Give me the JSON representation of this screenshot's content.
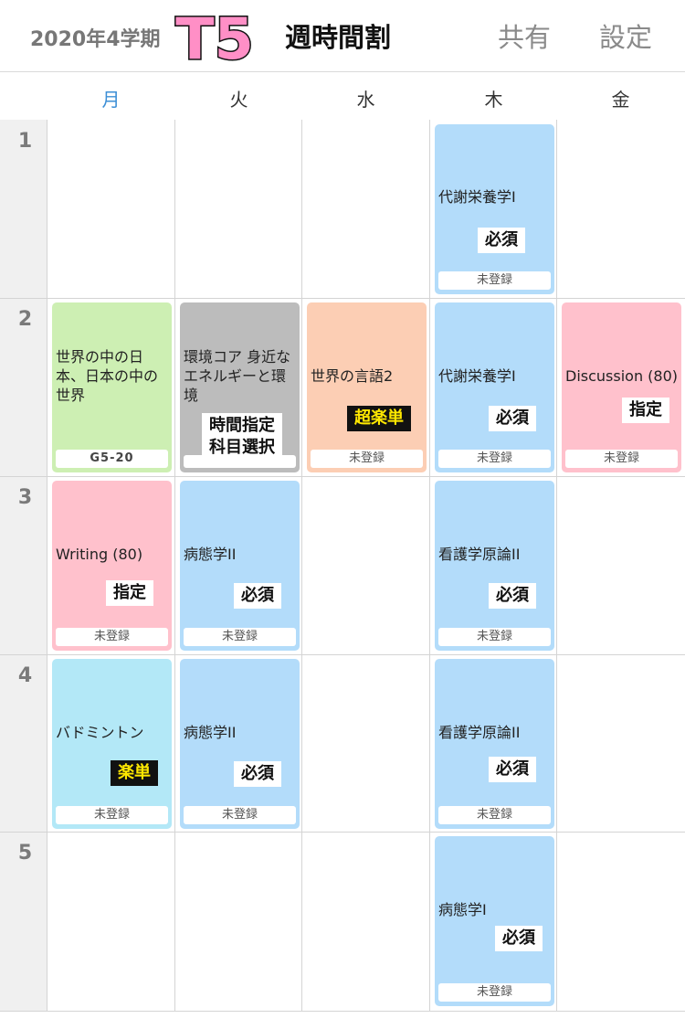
{
  "header": {
    "term": "2020年4学期",
    "logo": "T5",
    "title": "週時間割",
    "share_label": "共有",
    "settings_label": "設定"
  },
  "days": [
    "月",
    "火",
    "水",
    "木",
    "金"
  ],
  "periods": [
    "1",
    "2",
    "3",
    "4",
    "5"
  ],
  "colors": {
    "accent_day": "#3d8fd6",
    "blue": "#b3dcfa",
    "green": "#cdefb3",
    "gray": "#bcbcbc",
    "peach": "#fcceb4",
    "pink": "#ffc1cc",
    "cyan": "#b3e8f7",
    "logo_fill": "#ff8fc6"
  },
  "courses": {
    "thu1": {
      "name": "代謝栄養学I",
      "tag": "必須",
      "status": "未登録"
    },
    "mon2": {
      "name": "世界の中の日本、日本の中の世界",
      "status": "G5-20"
    },
    "tue2": {
      "name": "環境コア 身近なエネルギーと環境",
      "tag": "時間指定科目選択"
    },
    "wed2": {
      "name": "世界の言語2",
      "tag": "超楽単",
      "status": "未登録"
    },
    "thu2": {
      "name": "代謝栄養学I",
      "tag": "必須",
      "status": "未登録"
    },
    "fri2": {
      "name": "Discussion (80)",
      "tag": "指定",
      "status": "未登録"
    },
    "mon3": {
      "name": "Writing (80)",
      "tag": "指定",
      "status": "未登録"
    },
    "tue3": {
      "name": "病態学II",
      "tag": "必須",
      "status": "未登録"
    },
    "thu3": {
      "name": "看護学原論II",
      "tag": "必須",
      "status": "未登録"
    },
    "mon4": {
      "name": "バドミントン",
      "tag": "楽単",
      "status": "未登録"
    },
    "tue4": {
      "name": "病態学II",
      "tag": "必須",
      "status": "未登録"
    },
    "thu4": {
      "name": "看護学原論II",
      "tag": "必須",
      "status": "未登録"
    },
    "thu5": {
      "name": "病態学I",
      "tag": "必須",
      "status": "未登録"
    }
  }
}
